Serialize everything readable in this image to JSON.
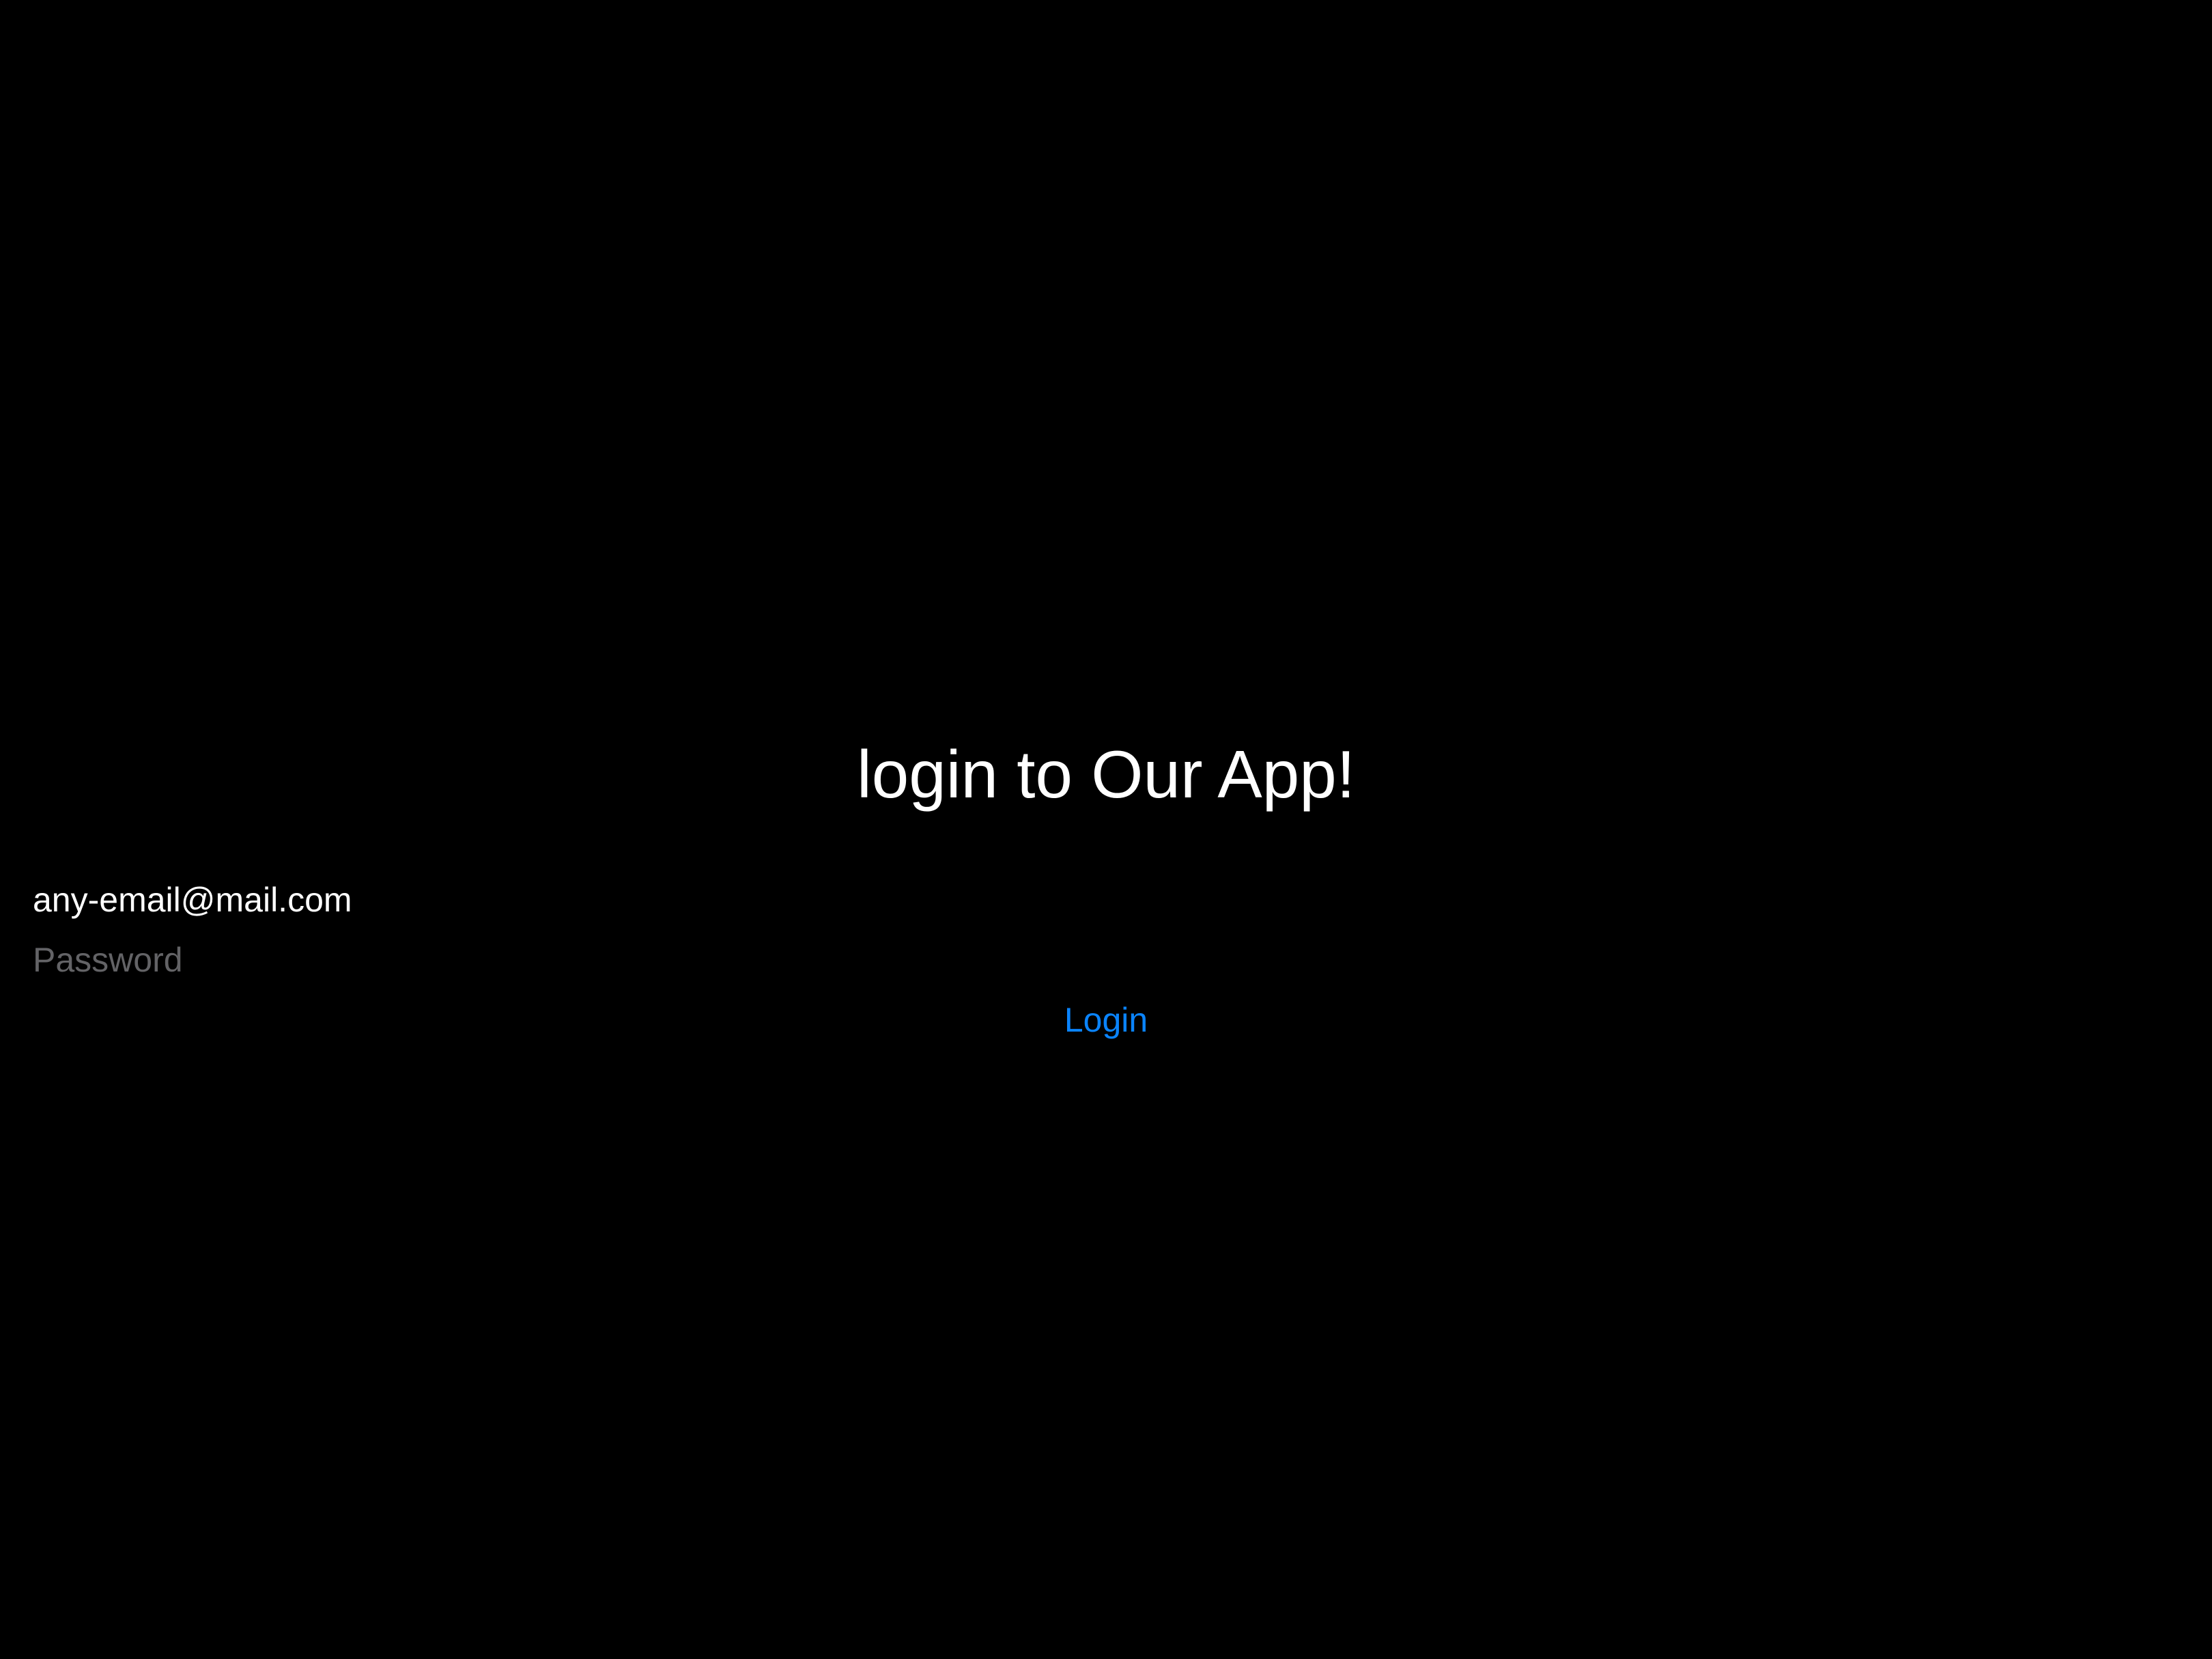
{
  "app": {
    "title": "login to Our App!"
  },
  "form": {
    "email_value": "any-email@mail.com",
    "password_placeholder": "Password",
    "password_value": "",
    "login_label": "Login"
  },
  "colors": {
    "background": "#000000",
    "text": "#ffffff",
    "placeholder": "#636366",
    "accent": "#0a84ff"
  }
}
